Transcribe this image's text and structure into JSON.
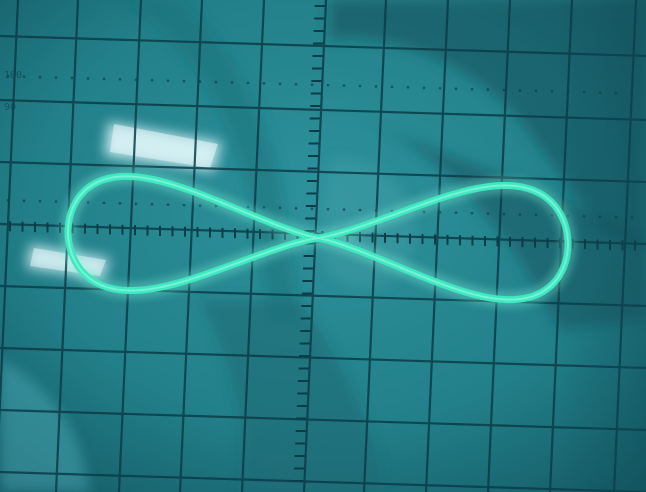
{
  "photo": {
    "subject": "oscilloscope-lissajous-figure-eight",
    "colors": {
      "screen": "#2a8a94",
      "screen_dark": "#0f4a55",
      "grid": "#0b3d48",
      "trace": "#3fe8c0",
      "trace_glow": "#7ff8d8",
      "glare": "#d8f4f8"
    }
  },
  "scale_marks": {
    "upper": "100",
    "lower": "90"
  }
}
